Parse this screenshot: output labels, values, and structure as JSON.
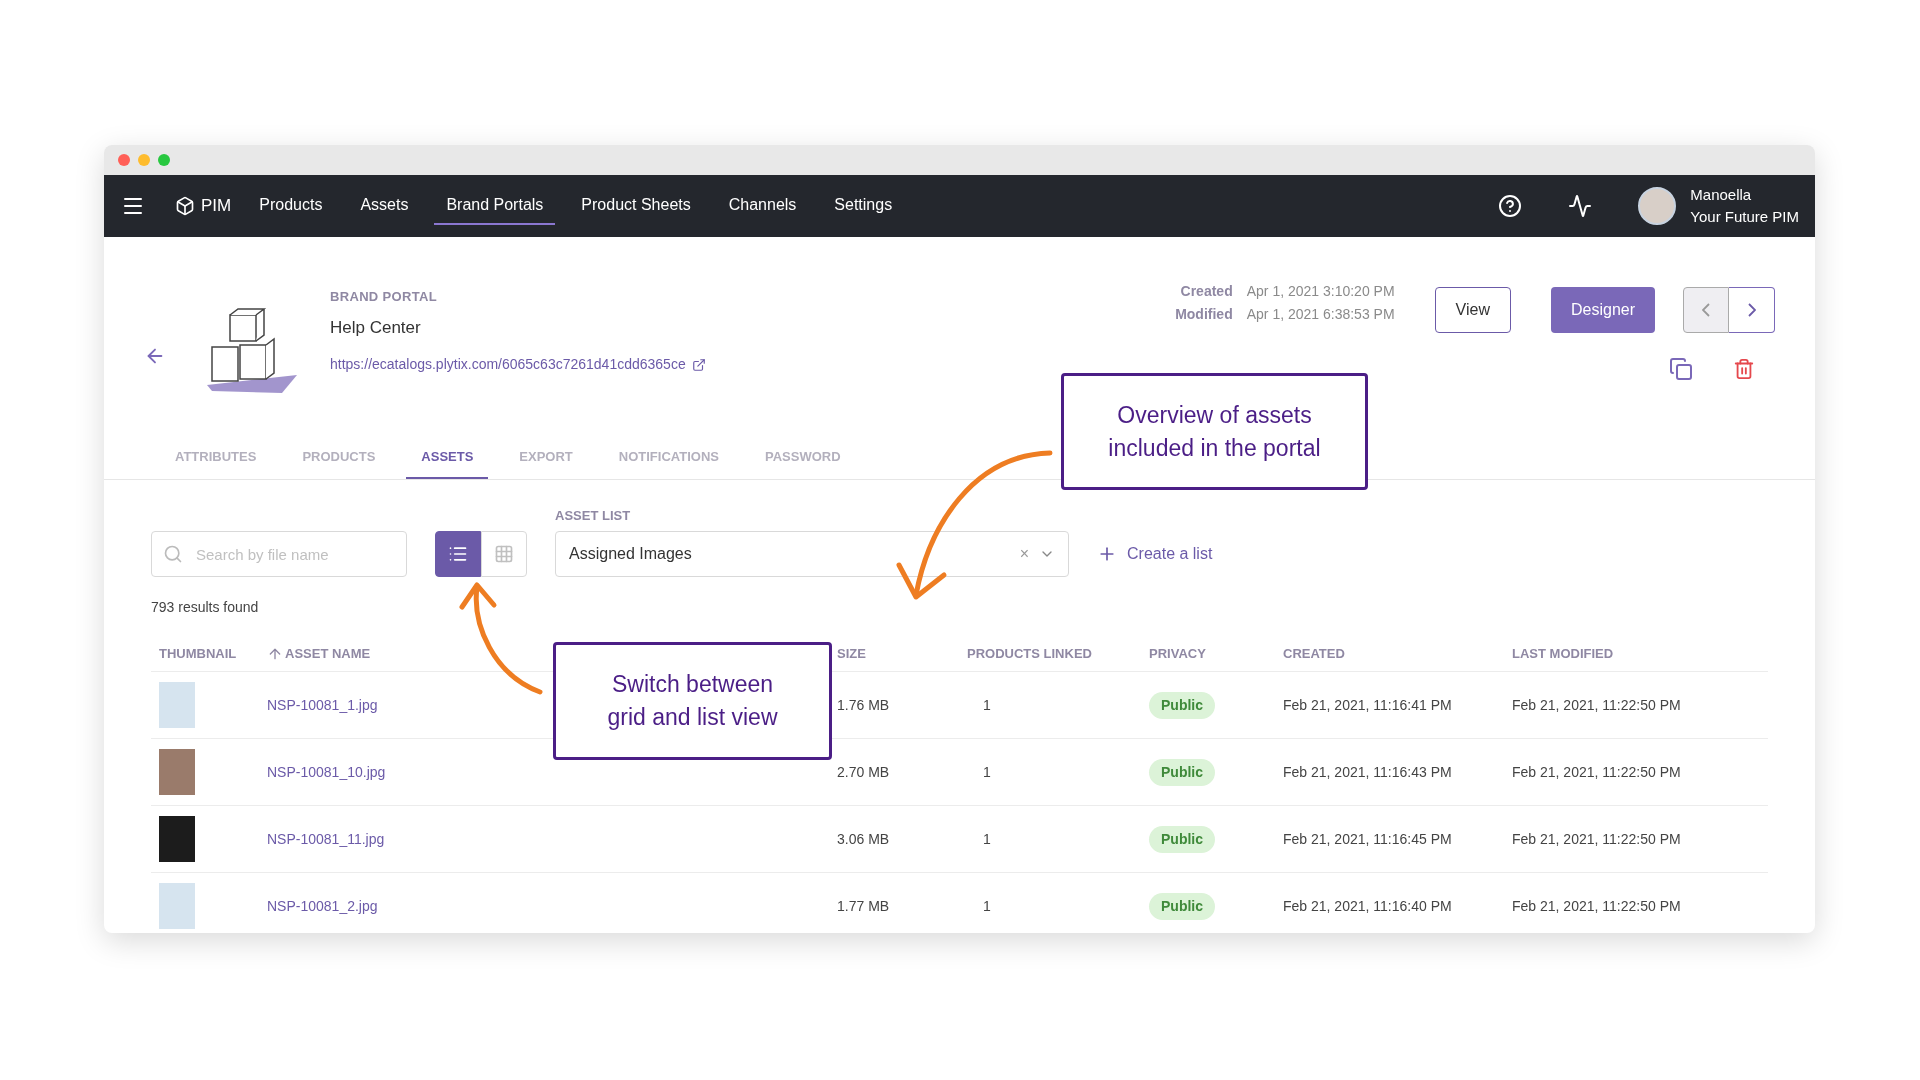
{
  "nav": {
    "brand": "PIM",
    "items": [
      {
        "label": "Products",
        "selected": false
      },
      {
        "label": "Assets",
        "selected": false
      },
      {
        "label": "Brand Portals",
        "selected": true
      },
      {
        "label": "Product Sheets",
        "selected": false
      },
      {
        "label": "Channels",
        "selected": false
      },
      {
        "label": "Settings",
        "selected": false
      }
    ],
    "user": {
      "name": "Manoella",
      "org": "Your Future PIM"
    }
  },
  "header": {
    "eyebrow": "BRAND PORTAL",
    "title": "Help Center",
    "url": "https://ecatalogs.plytix.com/6065c63c7261d41cdd6365ce",
    "meta": [
      {
        "label": "Created",
        "value": "Apr 1, 2021 3:10:20 PM"
      },
      {
        "label": "Modified",
        "value": "Apr 1, 2021 6:38:53 PM"
      }
    ],
    "buttons": [
      {
        "label": "View",
        "kind": "outline"
      },
      {
        "label": "Designer",
        "kind": "filled"
      }
    ],
    "pager": [
      {
        "kind": "prev",
        "disabled": true
      },
      {
        "kind": "next",
        "disabled": false
      }
    ]
  },
  "tabs": [
    {
      "label": "ATTRIBUTES",
      "selected": false
    },
    {
      "label": "PRODUCTS",
      "selected": false
    },
    {
      "label": "ASSETS",
      "selected": true
    },
    {
      "label": "EXPORT",
      "selected": false
    },
    {
      "label": "NOTIFICATIONS",
      "selected": false
    },
    {
      "label": "PASSWORD",
      "selected": false
    }
  ],
  "toolbar": {
    "search": {
      "placeholder": "Search by file name"
    },
    "views": [
      {
        "kind": "list",
        "selected": true
      },
      {
        "kind": "grid",
        "selected": false
      }
    ],
    "asset_list": {
      "label": "ASSET LIST",
      "value": "Assigned Images",
      "clear": "×"
    },
    "create": "Create a list"
  },
  "results": "793 results found",
  "table": {
    "columns": [
      "THUMBNAIL",
      "ASSET NAME",
      "SIZE",
      "PRODUCTS LINKED",
      "PRIVACY",
      "CREATED",
      "LAST MODIFIED"
    ],
    "rows": [
      {
        "name": "NSP-10081_1.jpg",
        "size": "1.76 MB",
        "linked": "1",
        "privacy": "Public",
        "created": "Feb 21, 2021, 11:16:41 PM",
        "modified": "Feb 21, 2021, 11:22:50 PM"
      },
      {
        "name": "NSP-10081_10.jpg",
        "size": "2.70 MB",
        "linked": "1",
        "privacy": "Public",
        "created": "Feb 21, 2021, 11:16:43 PM",
        "modified": "Feb 21, 2021, 11:22:50 PM"
      },
      {
        "name": "NSP-10081_11.jpg",
        "size": "3.06 MB",
        "linked": "1",
        "privacy": "Public",
        "created": "Feb 21, 2021, 11:16:45 PM",
        "modified": "Feb 21, 2021, 11:22:50 PM"
      },
      {
        "name": "NSP-10081_2.jpg",
        "size": "1.77 MB",
        "linked": "1",
        "privacy": "Public",
        "created": "Feb 21, 2021, 11:16:40 PM",
        "modified": "Feb 21, 2021, 11:22:50 PM"
      }
    ]
  },
  "callouts": [
    "Overview of assets included in the portal",
    "Switch between grid and list view"
  ]
}
